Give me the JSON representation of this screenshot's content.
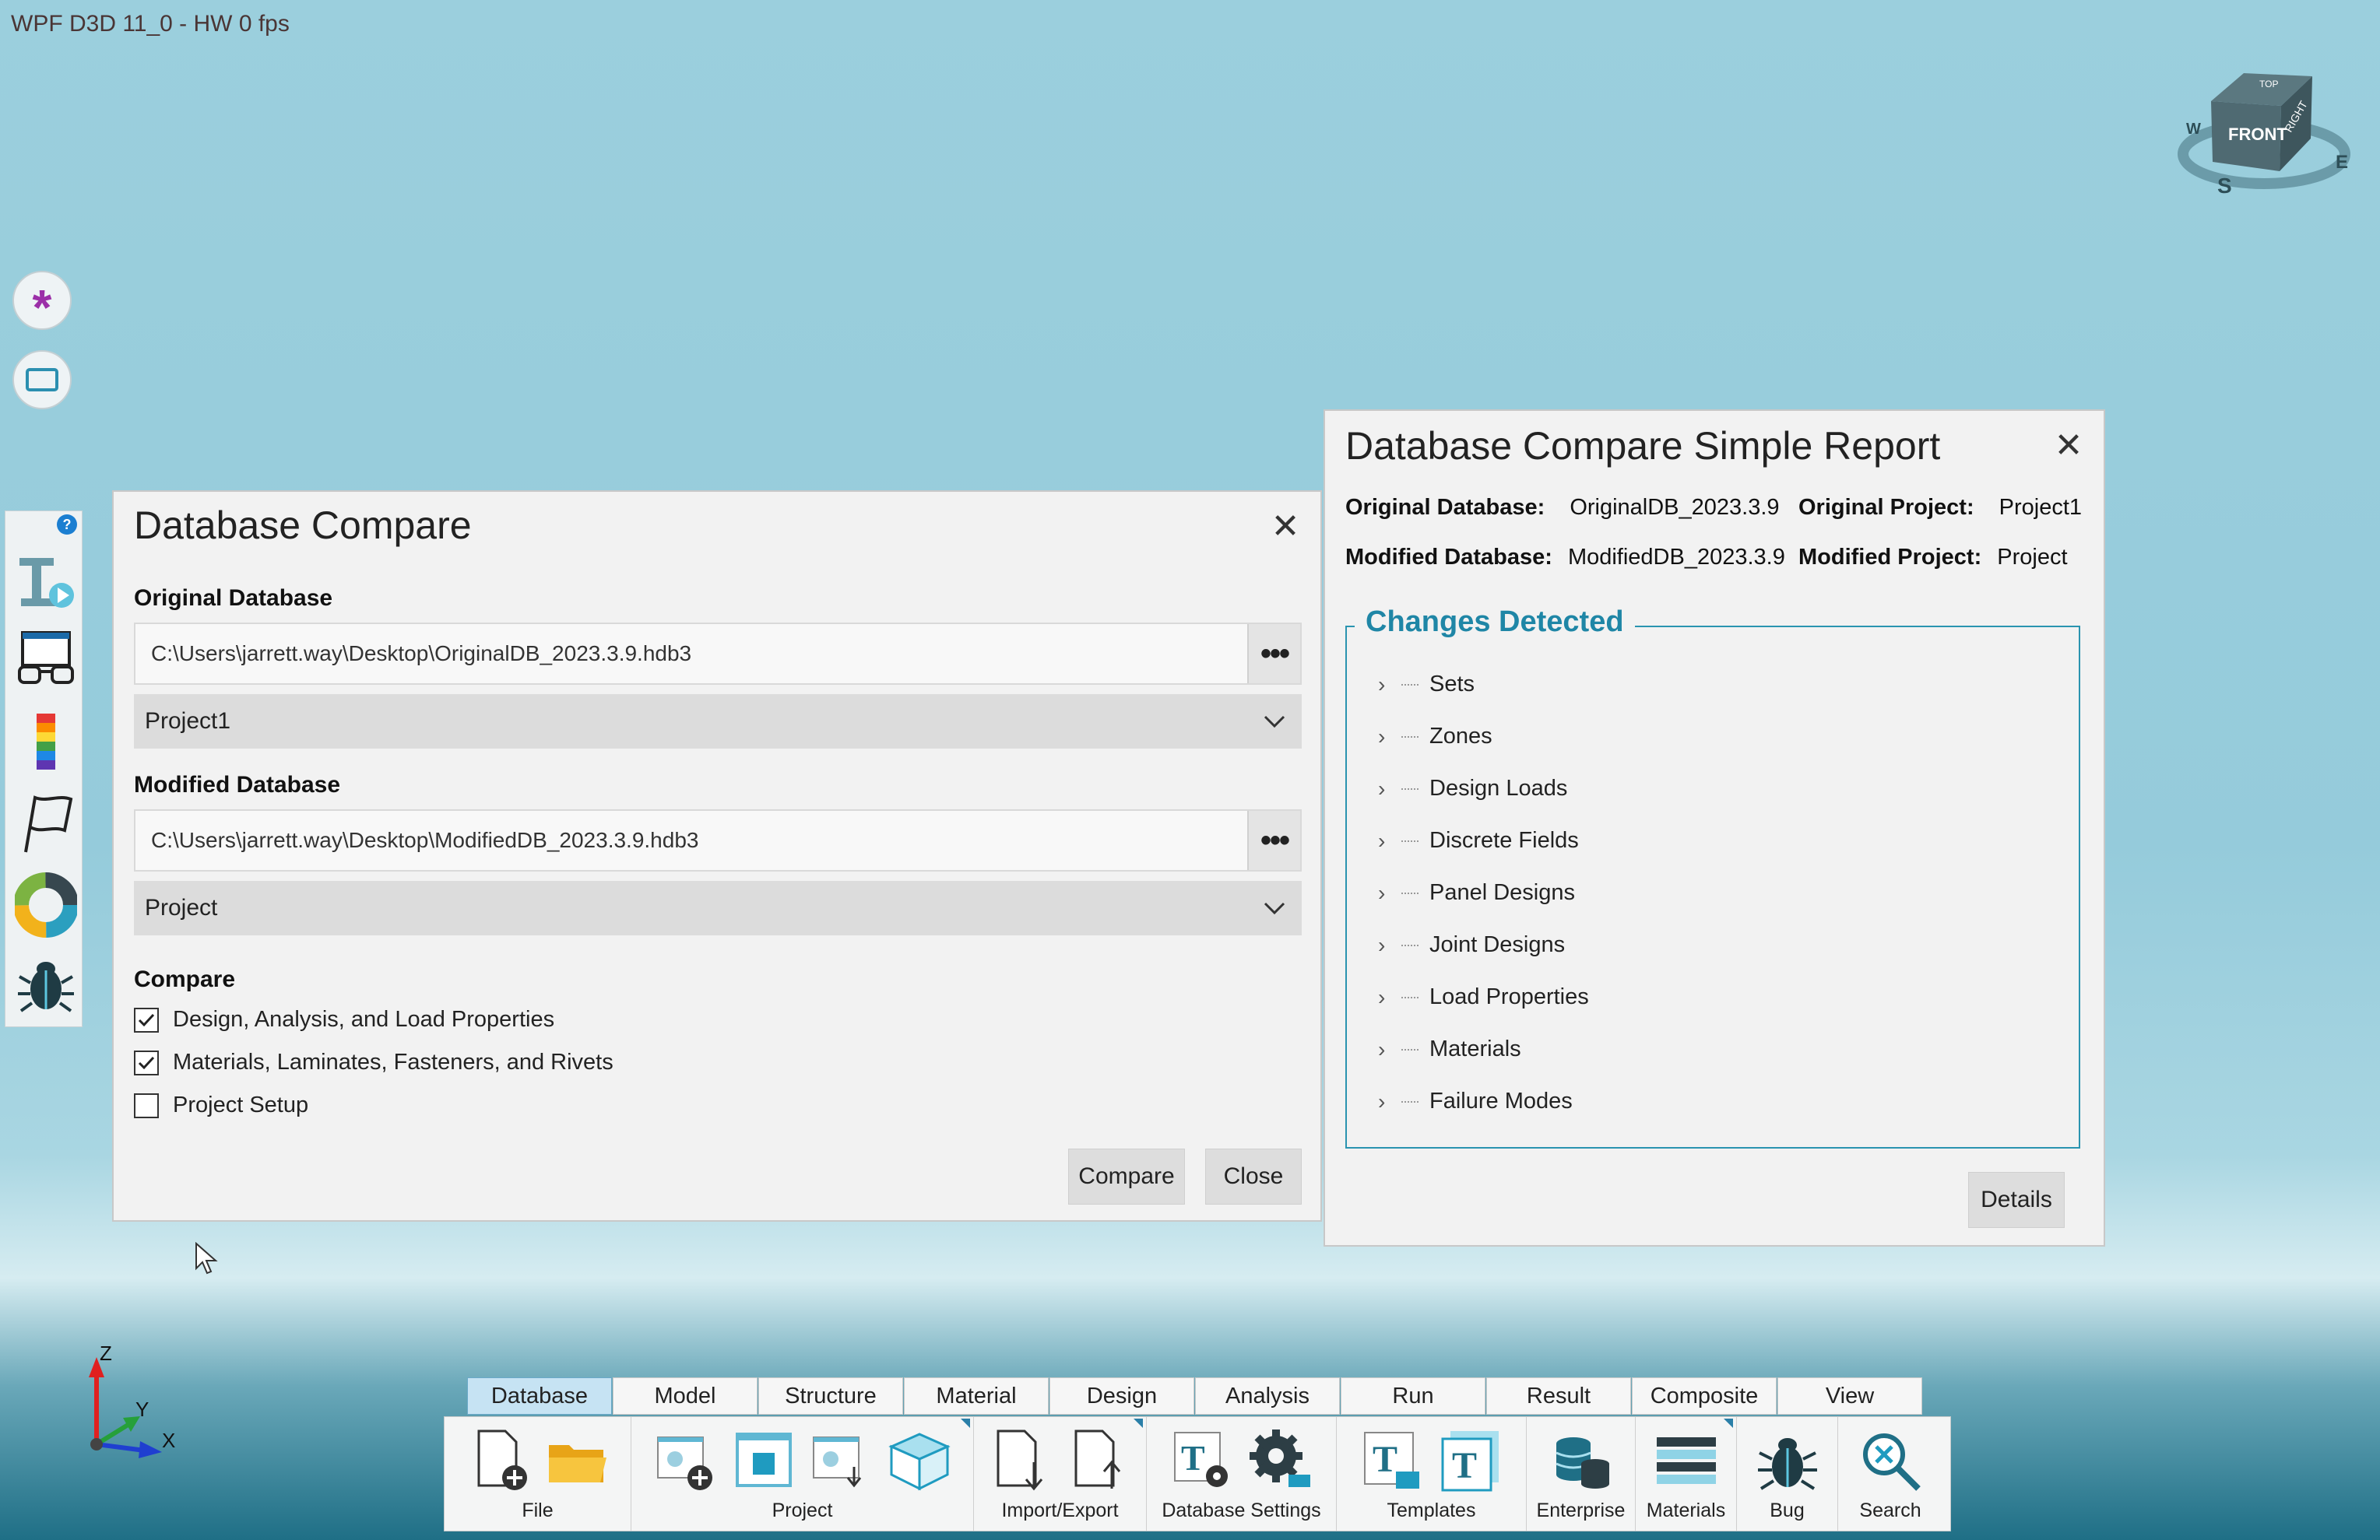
{
  "status_bar": {
    "text": "WPF D3D 11_0 - HW  0 fps"
  },
  "nav_cube": {
    "front": "FRONT",
    "right": "RIGHT",
    "top": "TOP",
    "south": "S",
    "east": "E",
    "west": "W"
  },
  "axes": {
    "z": "Z",
    "y": "Y",
    "x": "X"
  },
  "left_buttons": [
    {
      "icon": "asterisk-icon"
    },
    {
      "icon": "rectangle-select-icon"
    }
  ],
  "left_toolbar": {
    "help_badge": "?",
    "items": [
      "text-play-icon",
      "glasses-screen-icon",
      "color-scale-icon",
      "flag-icon",
      "color-wheel-icon",
      "bug-icon"
    ]
  },
  "compare_dialog": {
    "title": "Database Compare",
    "original_label": "Original Database",
    "original_path": "C:\\Users\\jarrett.way\\Desktop\\OriginalDB_2023.3.9.hdb3",
    "original_project": "Project1",
    "modified_label": "Modified Database",
    "modified_path": "C:\\Users\\jarrett.way\\Desktop\\ModifiedDB_2023.3.9.hdb3",
    "modified_project": "Project",
    "browse_label": "•••",
    "compare_label": "Compare",
    "checkboxes": [
      {
        "label": "Design, Analysis, and Load Properties",
        "checked": true
      },
      {
        "label": "Materials, Laminates, Fasteners, and Rivets",
        "checked": true
      },
      {
        "label": "Project Setup",
        "checked": false
      }
    ],
    "compare_button": "Compare",
    "close_button": "Close"
  },
  "report_dialog": {
    "title": "Database Compare Simple Report",
    "original_db_label": "Original Database:",
    "original_db_value": "OriginalDB_2023.3.9",
    "original_project_label": "Original Project:",
    "original_project_value": "Project1",
    "modified_db_label": "Modified Database:",
    "modified_db_value": "ModifiedDB_2023.3.9",
    "modified_project_label": "Modified Project:",
    "modified_project_value": "Project",
    "changes_title": "Changes Detected",
    "changes": [
      "Sets",
      "Zones",
      "Design Loads",
      "Discrete Fields",
      "Panel Designs",
      "Joint Designs",
      "Load Properties",
      "Materials",
      "Failure Modes"
    ],
    "details_button": "Details"
  },
  "ribbon": {
    "tabs": [
      "Database",
      "Model",
      "Structure",
      "Material",
      "Design",
      "Analysis",
      "Run",
      "Result",
      "Composite",
      "View"
    ],
    "active_tab": "Database",
    "groups": [
      {
        "label": "File"
      },
      {
        "label": "Project"
      },
      {
        "label": "Import/Export"
      },
      {
        "label": "Database Settings"
      },
      {
        "label": "Templates"
      },
      {
        "label": "Enterprise"
      },
      {
        "label": "Materials"
      },
      {
        "label": "Bug"
      },
      {
        "label": "Search"
      }
    ]
  },
  "colors": {
    "accent": "#1f86a6",
    "active_tab": "#c6e3f3",
    "dialog_bg": "#f2f2f2"
  }
}
